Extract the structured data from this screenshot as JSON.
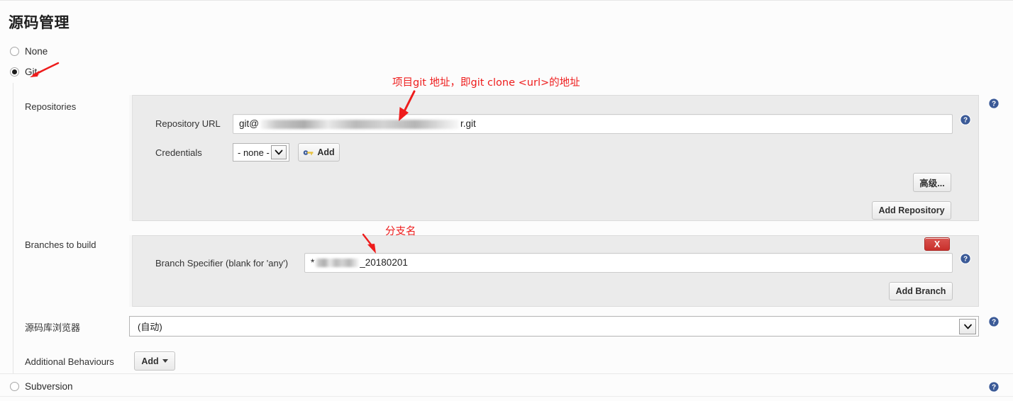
{
  "section": {
    "title": "源码管理"
  },
  "scm_options": [
    {
      "label": "None",
      "selected": false
    },
    {
      "label": "Git",
      "selected": true
    },
    {
      "label": "Subversion",
      "selected": false
    }
  ],
  "repositories": {
    "row_label": "Repositories",
    "url": {
      "label": "Repository URL",
      "value_prefix": "git@",
      "value_suffix": "r.git",
      "redacted": true
    },
    "credentials": {
      "label": "Credentials",
      "selected": "- none -",
      "add_button": "Add",
      "add_icon": "key-icon"
    },
    "advanced_button": "高级...",
    "add_repository_button": "Add Repository"
  },
  "branches": {
    "row_label": "Branches to build",
    "specifier": {
      "label": "Branch Specifier (blank for 'any')",
      "value_prefix": "*",
      "value_suffix": "_20180201",
      "redacted": true
    },
    "delete_button": "X",
    "add_branch_button": "Add Branch"
  },
  "repository_browser": {
    "label": "源码库浏览器",
    "selected": "(自动)"
  },
  "additional_behaviours": {
    "label": "Additional Behaviours",
    "add_button": "Add"
  },
  "annotations": [
    {
      "name": "git-radio-note",
      "text": ""
    },
    {
      "name": "repository-url-note",
      "text": "项目git 地址，即git clone <url>的地址"
    },
    {
      "name": "branch-name-note",
      "text": "分支名"
    }
  ],
  "colors": {
    "annotation_red": "#ee1c1c",
    "delete_button_red": "#c9302c",
    "help_icon_blue": "#3b5a97",
    "panel_bg": "#ebebeb"
  },
  "icons": {
    "help": "help-icon",
    "chevron_down": "chevron-down-icon",
    "caret_down": "caret-down-icon"
  }
}
